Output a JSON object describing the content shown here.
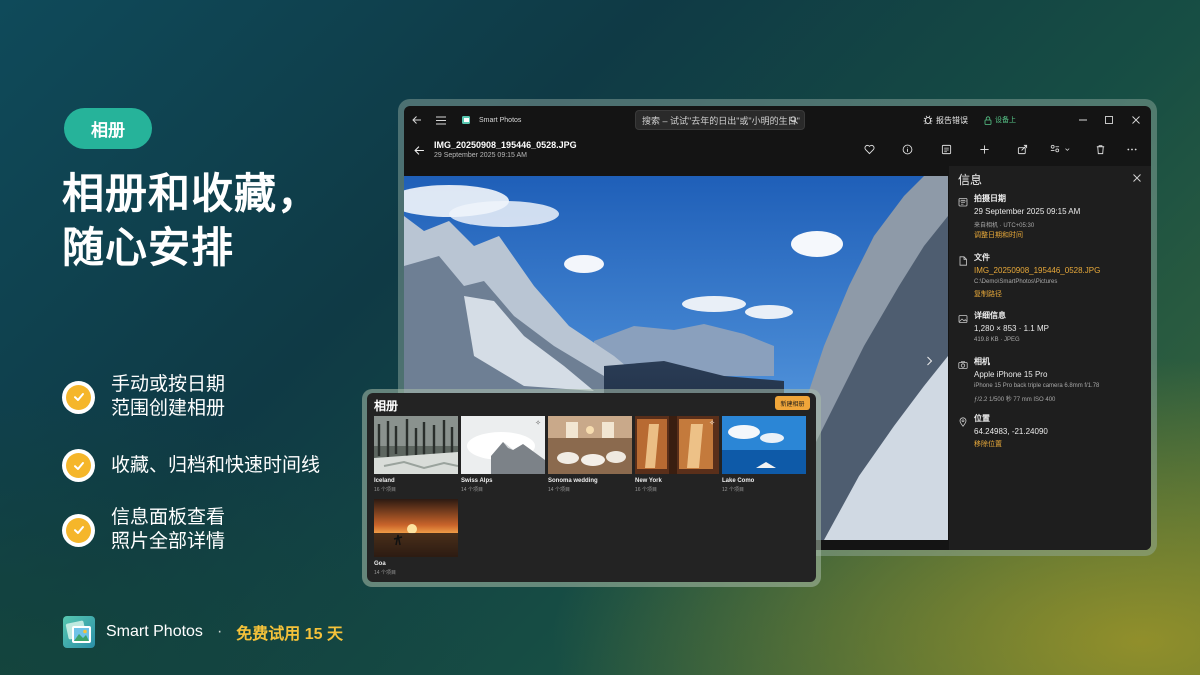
{
  "promo": {
    "tag": "相册",
    "headline_line1": "相册和收藏，",
    "headline_line2": "随心安排",
    "features": [
      {
        "line1": "手动或按日期",
        "line2": "范围创建相册"
      },
      {
        "line1": "收藏、归档和快速时间线",
        "line2": ""
      },
      {
        "line1": "信息面板查看",
        "line2": "照片全部详情"
      }
    ],
    "brand": "Smart Photos",
    "separator": "·",
    "trial": "免费试用 15 天"
  },
  "window": {
    "app_title": "Smart Photos",
    "search_placeholder": "搜索 – 试试\"去年的日出\"或\"小明的生日\"",
    "report_bug": "报告错误",
    "on_device": "设备上",
    "file_name": "IMG_20250908_195446_0528.JPG",
    "file_date": "29 September 2025 09:15 AM"
  },
  "info": {
    "title": "信息",
    "date": {
      "head": "拍摄日期",
      "value": "29 September 2025 09:15 AM",
      "sub": "来自相机 · UTC+05:30",
      "action": "调整日期和时间"
    },
    "file": {
      "head": "文件",
      "value": "IMG_20250908_195446_0528.JPG",
      "sub": "C:\\Demo\\SmartPhotos\\Pictures",
      "action": "复制路径"
    },
    "details": {
      "head": "详细信息",
      "value": "1,280 × 853 · 1.1 MP",
      "sub": "419.8 KB · JPEG"
    },
    "camera": {
      "head": "相机",
      "value": "Apple iPhone 15 Pro",
      "sub": "iPhone 15 Pro back triple camera 6.8mm f/1.78",
      "sub2": "ƒ/2.2    1/500 秒    77 mm    ISO 400"
    },
    "location": {
      "head": "位置",
      "value": "64.24983, -21.24090",
      "action": "移除位置"
    }
  },
  "albums": {
    "title": "相册",
    "new_button": "新建相册",
    "items": [
      {
        "name": "Iceland",
        "count": "16 个项目"
      },
      {
        "name": "Swiss Alps",
        "count": "14 个项目"
      },
      {
        "name": "Sonoma wedding",
        "count": "14 个项目"
      },
      {
        "name": "New York",
        "count": "16 个项目"
      },
      {
        "name": "Lake Como",
        "count": "12 个项目"
      },
      {
        "name": "Goa",
        "count": "14 个项目"
      }
    ]
  },
  "colors": {
    "accent_teal": "#26b39a",
    "accent_gold": "#f5c23a",
    "accent_orange": "#f0a63a"
  }
}
